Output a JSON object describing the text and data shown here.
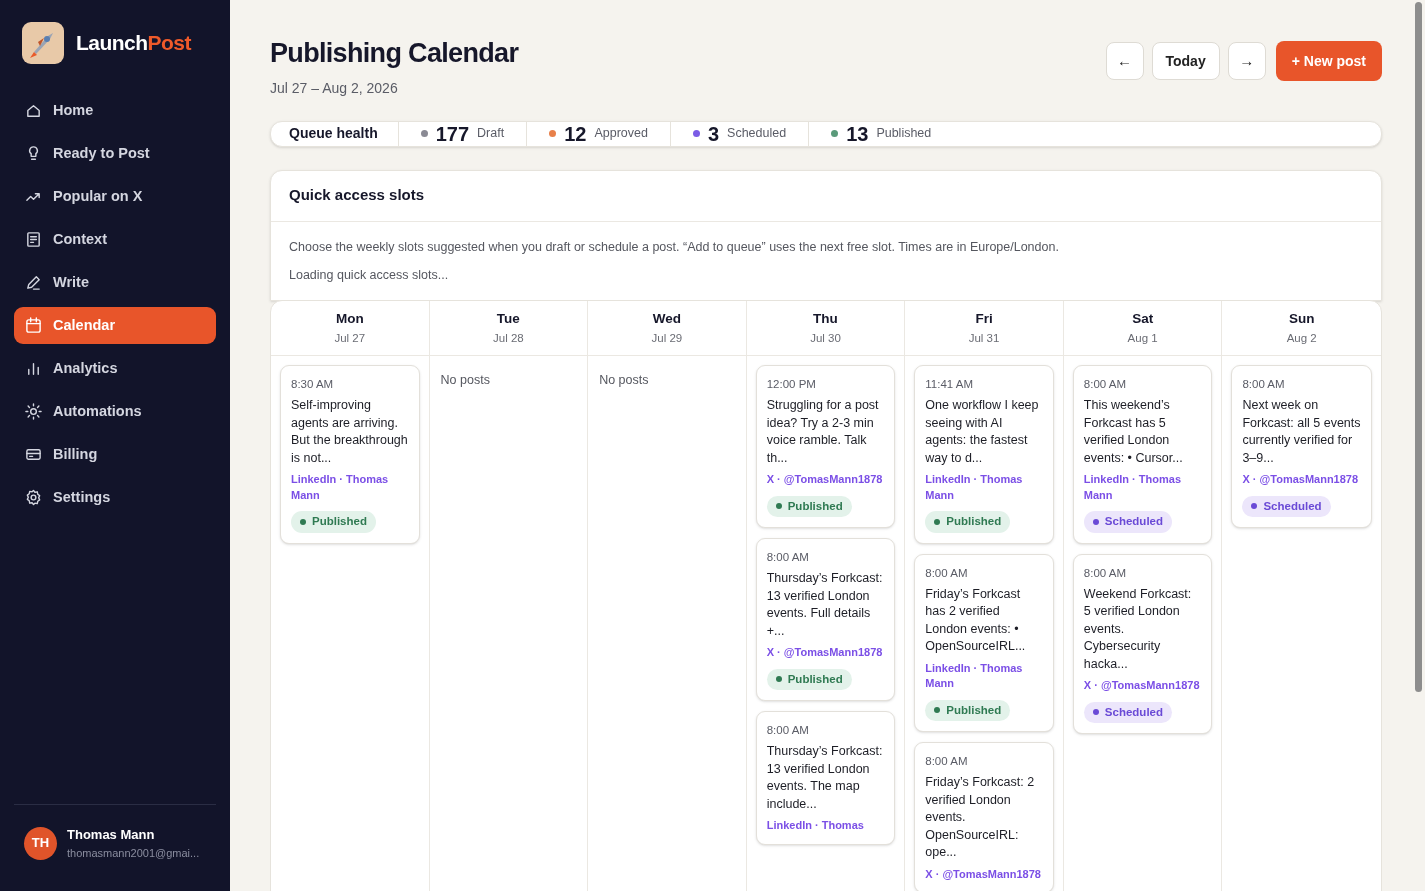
{
  "brand": {
    "name": "Launch",
    "accent": "Post"
  },
  "nav": [
    {
      "label": "Home",
      "selected": false
    },
    {
      "label": "Ready to Post",
      "selected": false
    },
    {
      "label": "Popular on X",
      "selected": false
    },
    {
      "label": "Context",
      "selected": false
    },
    {
      "label": "Write",
      "selected": false
    },
    {
      "label": "Calendar",
      "selected": true
    },
    {
      "label": "Analytics",
      "selected": false
    },
    {
      "label": "Automations",
      "selected": false
    },
    {
      "label": "Billing",
      "selected": false
    },
    {
      "label": "Settings",
      "selected": false
    }
  ],
  "user": {
    "initials": "TH",
    "name": "Thomas Mann",
    "email": "thomasmann2001@gmai..."
  },
  "header": {
    "title": "Publishing Calendar",
    "range": "Jul 27 – Aug 2, 2026",
    "prev": "←",
    "today": "Today",
    "next": "→",
    "new_post": "+ New post"
  },
  "queue_health": {
    "label": "Queue health",
    "stats": [
      {
        "count": "177",
        "label": "Draft",
        "color": "#8a8a94"
      },
      {
        "count": "12",
        "label": "Approved",
        "color": "#e8804a"
      },
      {
        "count": "3",
        "label": "Scheduled",
        "color": "#7b5ce6"
      },
      {
        "count": "13",
        "label": "Published",
        "color": "#5a9a7a"
      }
    ]
  },
  "quick_slots": {
    "title": "Quick access slots",
    "description": "Choose the weekly slots suggested when you draft or schedule a post. “Add to queue” uses the next free slot. Times are in Europe/London.",
    "loading": "Loading quick access slots..."
  },
  "days": [
    {
      "day": "Mon",
      "date": "Jul 27",
      "posts": [
        {
          "time": "8:30 AM",
          "text": "Self-improving agents are arriving. But the breakthrough is not...",
          "channel": "LinkedIn · Thomas Mann",
          "status": {
            "kind": "published",
            "label": "Published"
          }
        }
      ]
    },
    {
      "day": "Tue",
      "date": "Jul 28",
      "empty": "No posts"
    },
    {
      "day": "Wed",
      "date": "Jul 29",
      "empty": "No posts"
    },
    {
      "day": "Thu",
      "date": "Jul 30",
      "posts": [
        {
          "time": "12:00 PM",
          "text": "Struggling for a post idea? Try a 2-3 min voice ramble. Talk th...",
          "channel": "X · @TomasMann1878",
          "status": {
            "kind": "published",
            "label": "Published"
          }
        },
        {
          "time": "8:00 AM",
          "text": "Thursday’s Forkcast: 13 verified London events. Full details +...",
          "channel": "X · @TomasMann1878",
          "status": {
            "kind": "published",
            "label": "Published"
          }
        },
        {
          "time": "8:00 AM",
          "text": "Thursday’s Forkcast: 13 verified London events. The map include...",
          "channel": "LinkedIn · Thomas"
        }
      ]
    },
    {
      "day": "Fri",
      "date": "Jul 31",
      "posts": [
        {
          "time": "11:41 AM",
          "text": "One workflow I keep seeing with AI agents: the fastest way to d...",
          "channel": "LinkedIn · Thomas Mann",
          "status": {
            "kind": "published",
            "label": "Published"
          }
        },
        {
          "time": "8:00 AM",
          "text": "Friday’s Forkcast has 2 verified London events: • OpenSourceIRL...",
          "channel": "LinkedIn · Thomas Mann",
          "status": {
            "kind": "published",
            "label": "Published"
          }
        },
        {
          "time": "8:00 AM",
          "text": "Friday’s Forkcast: 2 verified London events. OpenSourceIRL: ope...",
          "channel": "X · @TomasMann1878"
        }
      ]
    },
    {
      "day": "Sat",
      "date": "Aug 1",
      "posts": [
        {
          "time": "8:00 AM",
          "text": "This weekend’s Forkcast has 5 verified London events: • Cursor...",
          "channel": "LinkedIn · Thomas Mann",
          "status": {
            "kind": "scheduled",
            "label": "Scheduled"
          }
        },
        {
          "time": "8:00 AM",
          "text": "Weekend Forkcast: 5 verified London events. Cybersecurity hacka...",
          "channel": "X · @TomasMann1878",
          "status": {
            "kind": "scheduled",
            "label": "Scheduled"
          }
        }
      ]
    },
    {
      "day": "Sun",
      "date": "Aug 2",
      "posts": [
        {
          "time": "8:00 AM",
          "text": "Next week on Forkcast: all 5 events currently verified for 3–9...",
          "channel": "X · @TomasMann1878",
          "status": {
            "kind": "scheduled",
            "label": "Scheduled"
          }
        }
      ]
    }
  ]
}
